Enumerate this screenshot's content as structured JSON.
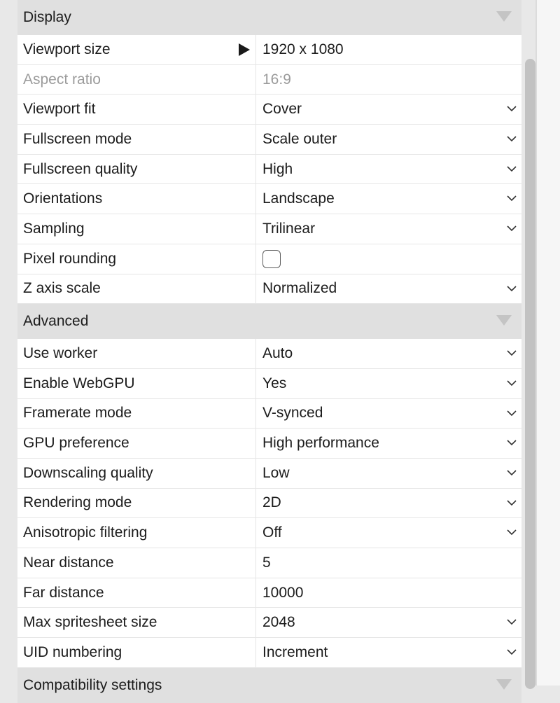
{
  "sections": [
    {
      "title": "Display",
      "rows": [
        {
          "label": "Viewport size",
          "value": "1920 x 1080",
          "kind": "expand"
        },
        {
          "label": "Aspect ratio",
          "value": "16:9",
          "kind": "readonly"
        },
        {
          "label": "Viewport fit",
          "value": "Cover",
          "kind": "dropdown"
        },
        {
          "label": "Fullscreen mode",
          "value": "Scale outer",
          "kind": "dropdown"
        },
        {
          "label": "Fullscreen quality",
          "value": "High",
          "kind": "dropdown"
        },
        {
          "label": "Orientations",
          "value": "Landscape",
          "kind": "dropdown"
        },
        {
          "label": "Sampling",
          "value": "Trilinear",
          "kind": "dropdown"
        },
        {
          "label": "Pixel rounding",
          "value": null,
          "kind": "checkbox",
          "checked": false
        },
        {
          "label": "Z axis scale",
          "value": "Normalized",
          "kind": "dropdown"
        }
      ]
    },
    {
      "title": "Advanced",
      "rows": [
        {
          "label": "Use worker",
          "value": "Auto",
          "kind": "dropdown"
        },
        {
          "label": "Enable WebGPU",
          "value": "Yes",
          "kind": "dropdown"
        },
        {
          "label": "Framerate mode",
          "value": "V-synced",
          "kind": "dropdown"
        },
        {
          "label": "GPU preference",
          "value": "High performance",
          "kind": "dropdown"
        },
        {
          "label": "Downscaling quality",
          "value": "Low",
          "kind": "dropdown"
        },
        {
          "label": "Rendering mode",
          "value": "2D",
          "kind": "dropdown"
        },
        {
          "label": "Anisotropic filtering",
          "value": "Off",
          "kind": "dropdown"
        },
        {
          "label": "Near distance",
          "value": "5",
          "kind": "text"
        },
        {
          "label": "Far distance",
          "value": "10000",
          "kind": "text"
        },
        {
          "label": "Max spritesheet size",
          "value": "2048",
          "kind": "dropdown"
        },
        {
          "label": "UID numbering",
          "value": "Increment",
          "kind": "dropdown"
        }
      ]
    }
  ],
  "next_section": {
    "title": "Compatibility settings"
  },
  "icons": {
    "collapse": "triangle-down-icon",
    "expand": "triangle-right-icon",
    "dropdown": "chevron-down-icon"
  }
}
